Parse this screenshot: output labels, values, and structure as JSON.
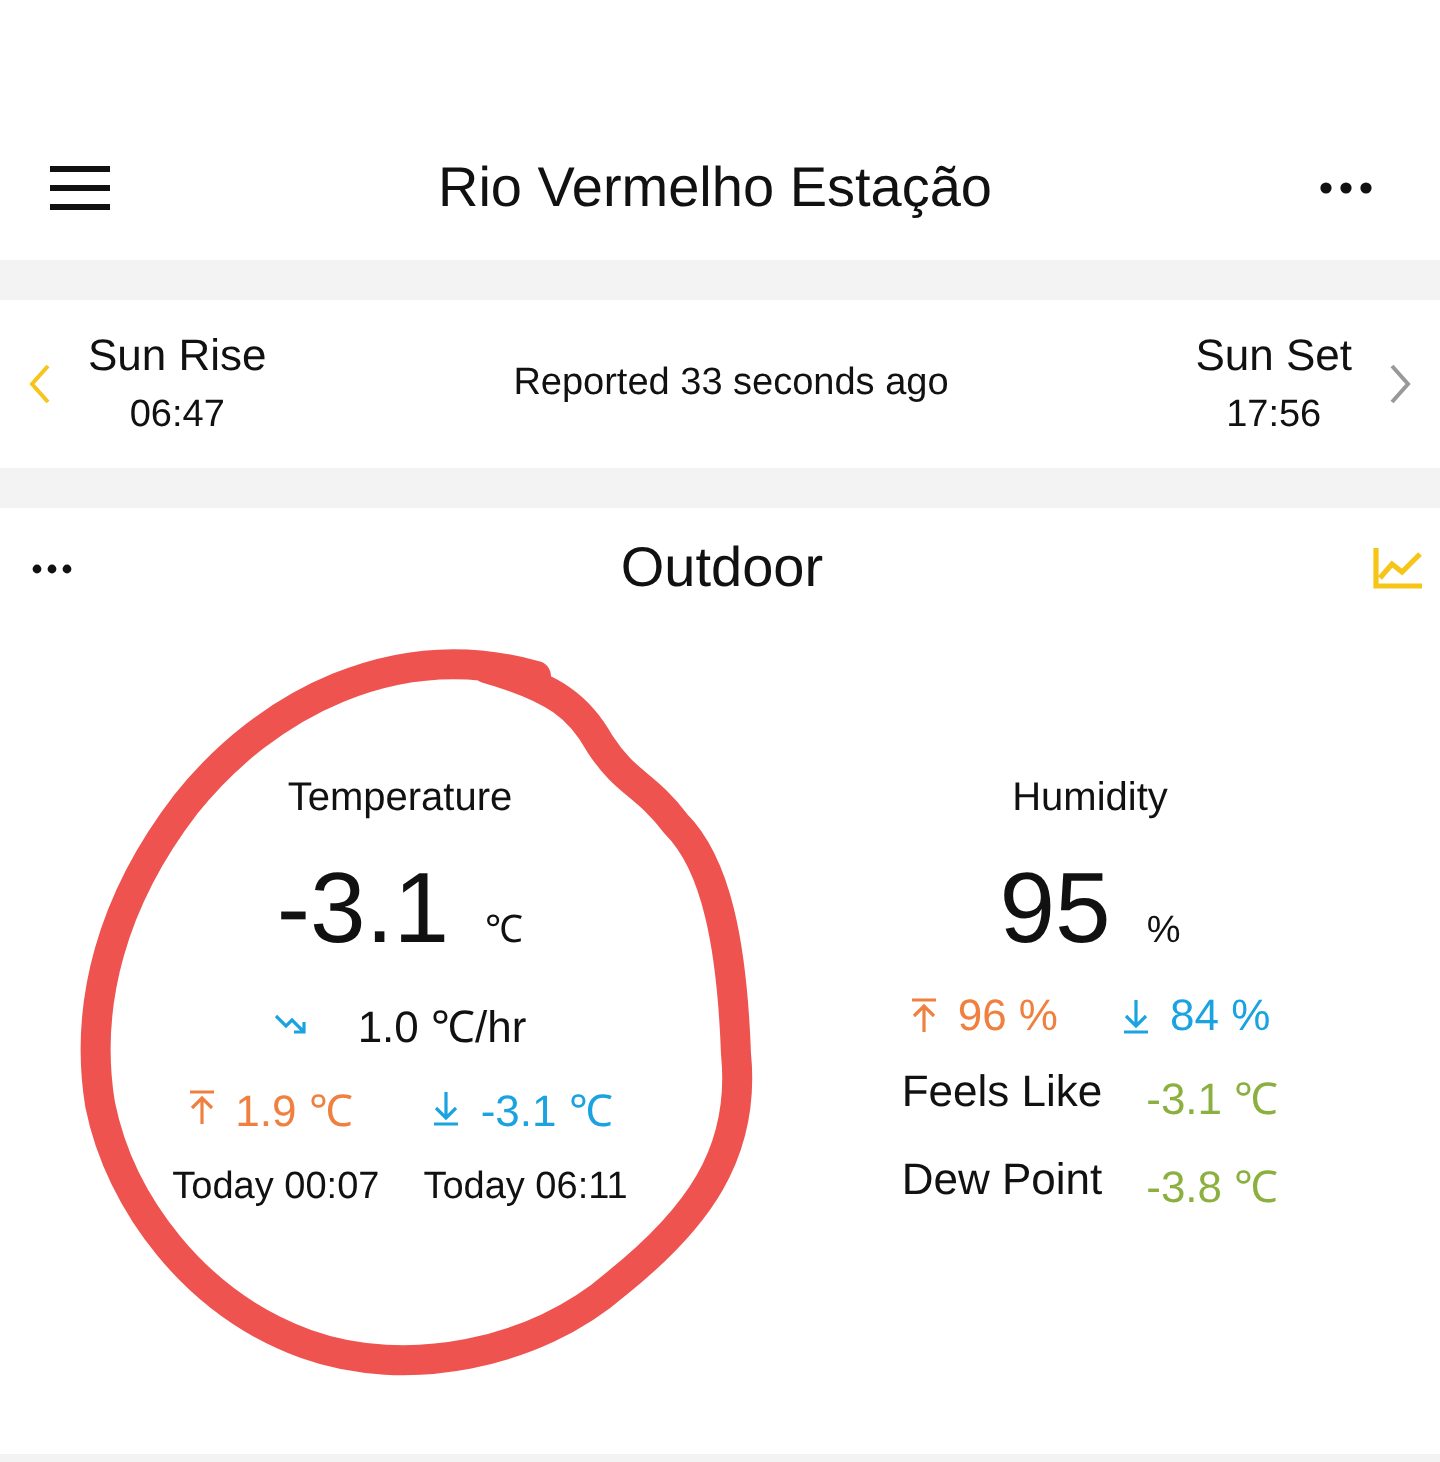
{
  "header": {
    "title": "Rio Vermelho Estação"
  },
  "sun": {
    "rise_label": "Sun Rise",
    "rise_time": "06:47",
    "reported": "Reported 33 seconds ago",
    "set_label": "Sun Set",
    "set_time": "17:56"
  },
  "outdoor": {
    "title": "Outdoor",
    "temperature": {
      "label": "Temperature",
      "value": "-3.1",
      "unit": "℃",
      "trend": "1.0 ℃/hr",
      "high": "1.9 ℃",
      "low": "-3.1 ℃",
      "high_time": "Today 00:07",
      "low_time": "Today 06:11"
    },
    "humidity": {
      "label": "Humidity",
      "value": "95",
      "unit": "%",
      "high": "96 %",
      "low": "84 %",
      "rows": [
        {
          "label": "Feels Like",
          "value": "-3.1 ℃"
        },
        {
          "label": "Dew Point",
          "value": "-3.8 ℃"
        }
      ]
    }
  }
}
